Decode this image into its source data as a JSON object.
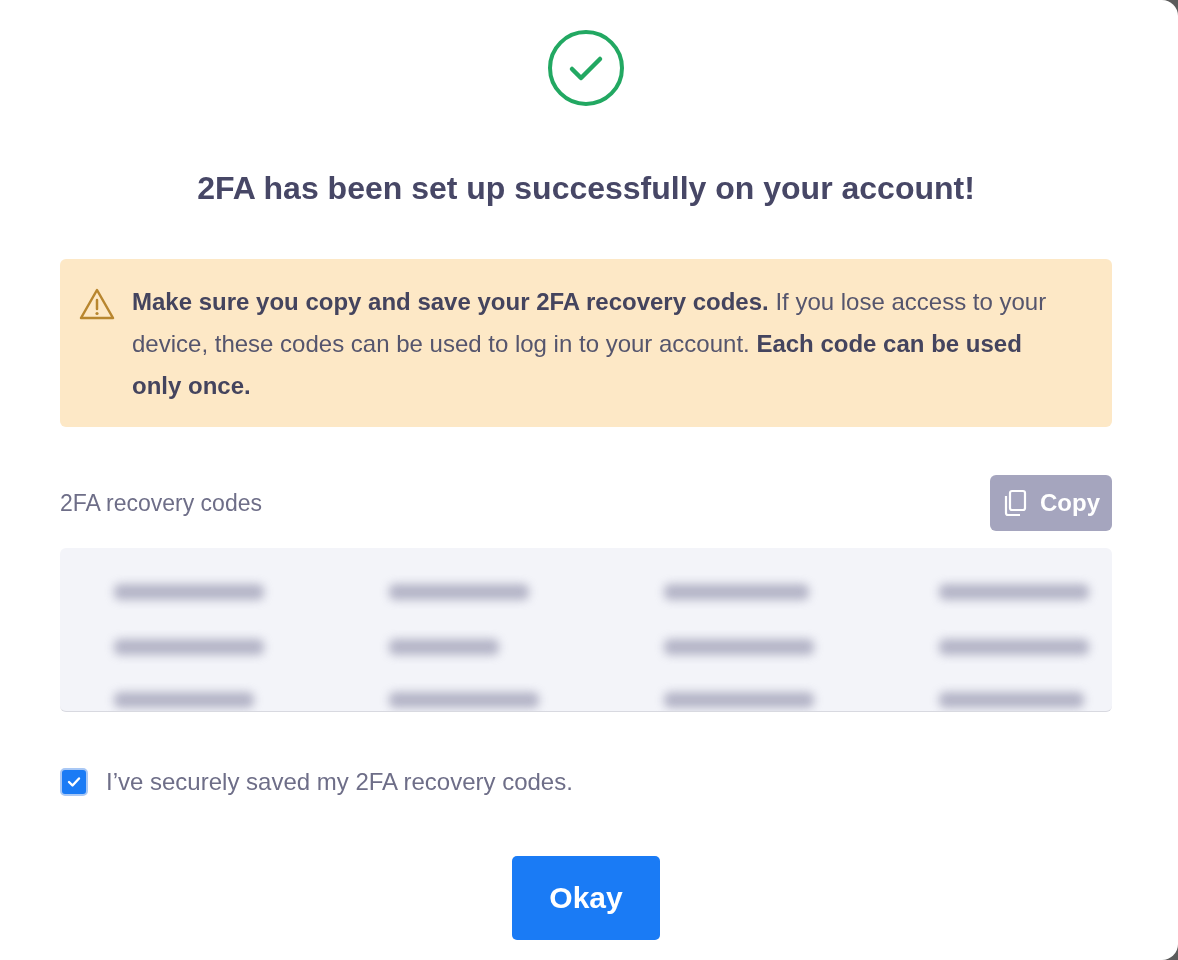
{
  "title": "2FA has been set up successfully on your account!",
  "alert": {
    "text": "**Make sure you copy and save your 2FA recovery codes.** If you lose access to your device, these codes can be used to log in to your account. **Each code can be used only once.**"
  },
  "codes_label": "2FA recovery codes",
  "copy_button": {
    "label": "Copy",
    "disabled": true
  },
  "confirm": {
    "label": "I’ve securely saved my 2FA recovery codes.",
    "checked": true
  },
  "ok_button": "Okay"
}
